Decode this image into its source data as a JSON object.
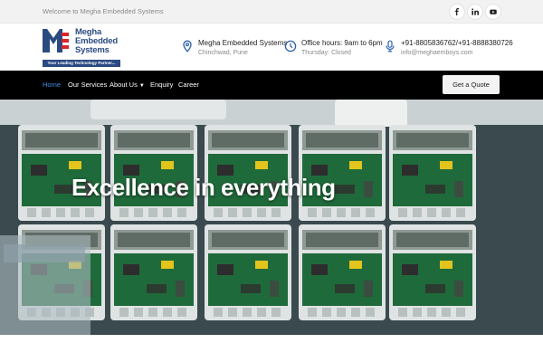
{
  "topbar": {
    "welcome": "Welcome to Megha Embedded Systems",
    "social": [
      {
        "icon": "facebook-icon"
      },
      {
        "icon": "linkedin-icon"
      },
      {
        "icon": "youtube-icon"
      }
    ]
  },
  "logo": {
    "name_line1": "Megha",
    "name_line2": "Embedded",
    "name_line3": "Systems",
    "tagline": "Your Leading Technology Partner...",
    "brand_color": "#2a4a82",
    "accent_color": "#d9262b"
  },
  "header": {
    "address": {
      "icon": "location-pin-icon",
      "title": "Megha Embedded Systems",
      "subtitle": "Chinchwad, Pune"
    },
    "hours": {
      "icon": "clock-icon",
      "title": "Office hours: 9am to 6pm",
      "subtitle": "Thursday: Closed"
    },
    "contact": {
      "icon": "microphone-icon",
      "title": "+91-8805836762/+91-8888380726",
      "subtitle": "info@meghaemboys.com"
    },
    "icon_color": "#2a5ea8"
  },
  "nav": {
    "items": [
      {
        "label": "Home",
        "active": true
      },
      {
        "label": "Our Services"
      },
      {
        "label": "About Us",
        "has_dropdown": true
      },
      {
        "label": "Enquiry"
      },
      {
        "label": "Career"
      }
    ],
    "active_color": "#3f8ce6",
    "quote_button": "Get a Quote"
  },
  "hero": {
    "title": "Excellence in everything"
  }
}
